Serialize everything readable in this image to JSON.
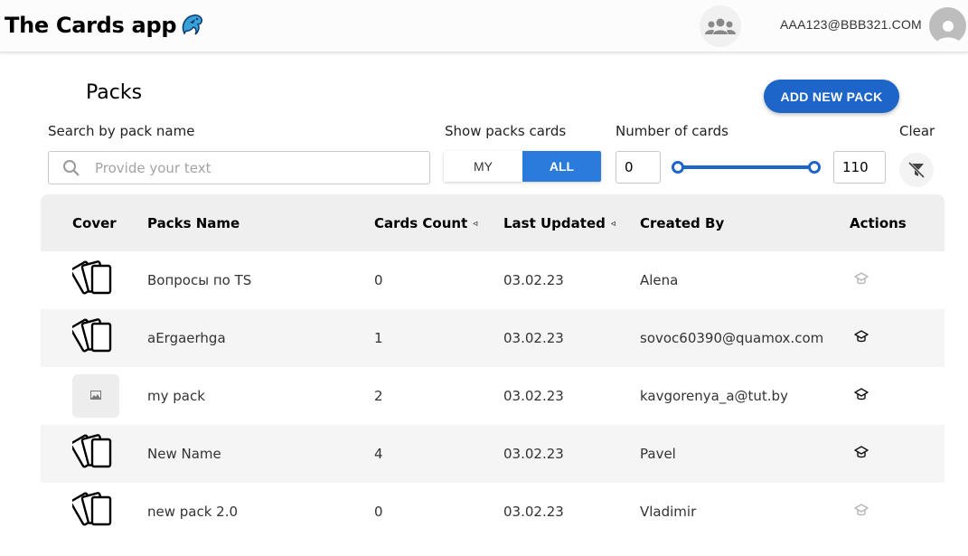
{
  "header": {
    "app_title": "The Cards app",
    "email": "AAA123@BBB321.COM"
  },
  "page": {
    "title": "Packs",
    "add_button": "ADD NEW PACK"
  },
  "filters": {
    "search_label": "Search by pack name",
    "search_placeholder": "Provide your text",
    "show_label": "Show packs cards",
    "toggle_my": "MY",
    "toggle_all": "ALL",
    "toggle_selected": "ALL",
    "number_label": "Number of cards",
    "min_value": "0",
    "max_value": "110",
    "clear_label": "Clear"
  },
  "table": {
    "columns": {
      "cover": "Cover",
      "name": "Packs Name",
      "count": "Cards Count",
      "updated": "Last Updated",
      "created_by": "Created By",
      "actions": "Actions"
    },
    "sort_icon": "◃",
    "rows": [
      {
        "cover": "cards-icon",
        "name": "Вопросы по TS",
        "count": "0",
        "updated": "03.02.23",
        "created_by": "Alena",
        "action_state": "disabled"
      },
      {
        "cover": "cards-icon",
        "name": "aErgaerhga",
        "count": "1",
        "updated": "03.02.23",
        "created_by": "sovoc60390@quamox.com",
        "action_state": "enabled"
      },
      {
        "cover": "no-image",
        "name": "my pack",
        "count": "2",
        "updated": "03.02.23",
        "created_by": "kavgorenya_a@tut.by",
        "action_state": "enabled"
      },
      {
        "cover": "cards-icon",
        "name": "New Name",
        "count": "4",
        "updated": "03.02.23",
        "created_by": "Pavel",
        "action_state": "enabled"
      },
      {
        "cover": "cards-icon",
        "name": "new pack 2.0",
        "count": "0",
        "updated": "03.02.23",
        "created_by": "Vladimir",
        "action_state": "disabled"
      }
    ]
  },
  "colors": {
    "accent": "#1d65c9",
    "toggle_active": "#2a7bdc",
    "slider": "#1d65c9"
  }
}
